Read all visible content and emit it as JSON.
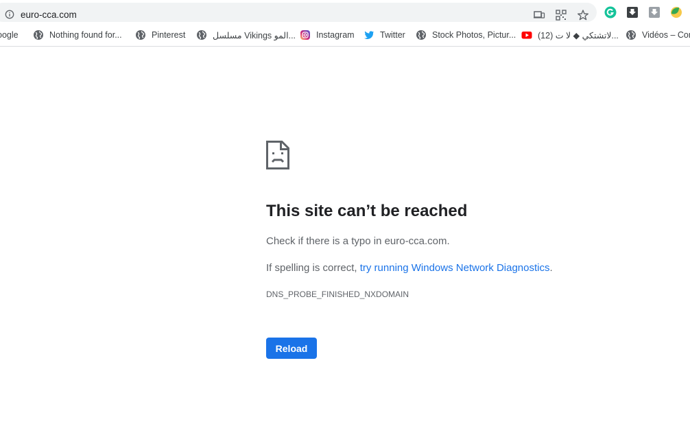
{
  "browser": {
    "url": "euro-cca.com",
    "bookmarks": [
      {
        "label": "oogle",
        "icon": "google-icon"
      },
      {
        "label": "Nothing found for...",
        "icon": "globe-icon"
      },
      {
        "label": "Pinterest",
        "icon": "globe-icon"
      },
      {
        "label": "مسلسل Vikings المو...",
        "icon": "globe-icon"
      },
      {
        "label": "Instagram",
        "icon": "instagram-icon"
      },
      {
        "label": "Twitter",
        "icon": "twitter-icon"
      },
      {
        "label": "Stock Photos, Pictur...",
        "icon": "globe-icon"
      },
      {
        "label": "(12) لاتشتكي ◆ لا ت...",
        "icon": "youtube-icon"
      },
      {
        "label": "Vidéos – Com",
        "icon": "globe-icon"
      }
    ]
  },
  "error": {
    "title": "This site can’t be reached",
    "check_text": "Check if there is a typo in euro-cca.com.",
    "spelling_prefix": "If spelling is correct, ",
    "diagnostics_link": "try running Windows Network Diagnostics",
    "spelling_suffix": ".",
    "code": "DNS_PROBE_FINISHED_NXDOMAIN",
    "reload_label": "Reload"
  },
  "colors": {
    "accent": "#1a73e8",
    "title": "#202124",
    "body_text": "#5f6368",
    "omnibox_bg": "#f1f3f4"
  }
}
